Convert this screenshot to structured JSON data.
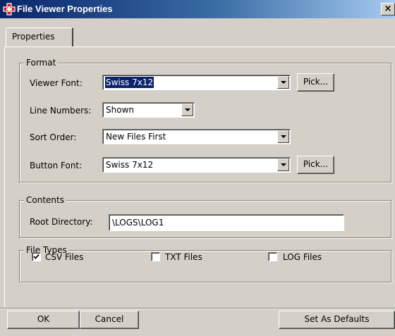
{
  "window": {
    "title": "File Viewer Properties",
    "close_glyph": "×",
    "accent": "#0a246a",
    "face_color": "#d4d0c8",
    "icon": "app-red-cross-icon"
  },
  "tabs": [
    {
      "label": "Properties",
      "selected": true
    }
  ],
  "format": {
    "legend": "Format",
    "viewer_font": {
      "label": "Viewer Font:",
      "value": "Swiss 7x12",
      "pick_label": "Pick..."
    },
    "line_numbers": {
      "label": "Line Numbers:",
      "value": "Shown"
    },
    "sort_order": {
      "label": "Sort Order:",
      "value": "New Files First"
    },
    "button_font": {
      "label": "Button Font:",
      "value": "Swiss 7x12",
      "pick_label": "Pick..."
    }
  },
  "contents": {
    "legend": "Contents",
    "root_directory": {
      "label": "Root Directory:",
      "value": "\\LOGS\\LOG1"
    }
  },
  "file_types": {
    "legend": "File Types",
    "items": [
      {
        "label": "CSV Files",
        "checked": true
      },
      {
        "label": "TXT Files",
        "checked": false
      },
      {
        "label": "LOG Files",
        "checked": false
      }
    ]
  },
  "footer": {
    "ok_label": "OK",
    "cancel_label": "Cancel",
    "defaults_label": "Set As Defaults"
  }
}
